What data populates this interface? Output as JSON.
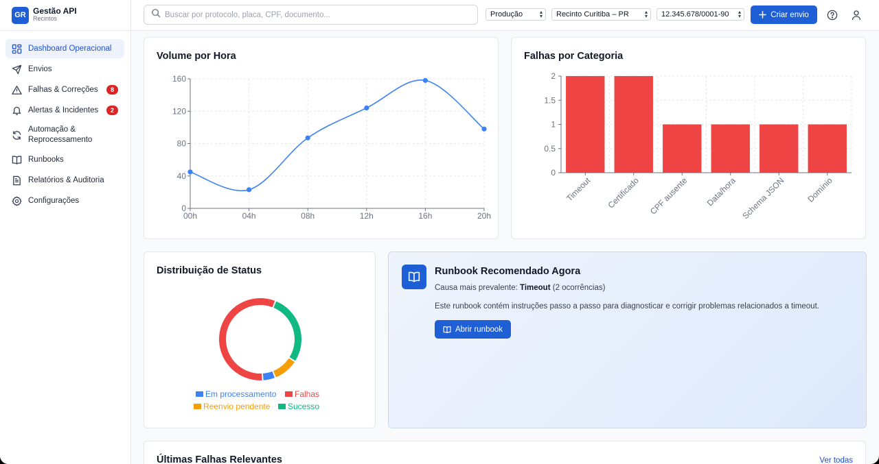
{
  "brand": {
    "logo": "GR",
    "title": "Gestão API",
    "subtitle": "Recintos"
  },
  "sidebar": {
    "items": [
      {
        "label": "Dashboard Operacional",
        "icon": "dashboard-grid-icon",
        "active": true
      },
      {
        "label": "Envios",
        "icon": "send-icon"
      },
      {
        "label": "Falhas & Correções",
        "icon": "warning-triangle-icon",
        "badge": "8"
      },
      {
        "label": "Alertas & Incidentes",
        "icon": "bell-icon",
        "badge": "2"
      },
      {
        "label": "Automação & Reprocessamento",
        "icon": "refresh-icon"
      },
      {
        "label": "Runbooks",
        "icon": "book-icon"
      },
      {
        "label": "Relatórios & Auditoria",
        "icon": "report-icon"
      },
      {
        "label": "Configurações",
        "icon": "gear-icon"
      }
    ]
  },
  "topbar": {
    "search_placeholder": "Buscar por protocolo, placa, CPF, documento...",
    "env_select": "Produção",
    "recinto_select": "Recinto Curitiba – PR",
    "cnpj_select": "12.345.678/0001-90",
    "create_button": "Criar envio"
  },
  "volume_card": {
    "title": "Volume por Hora",
    "chart_data": {
      "type": "line",
      "x": [
        "00h",
        "04h",
        "08h",
        "12h",
        "16h",
        "20h"
      ],
      "values": [
        45,
        23,
        87,
        124,
        158,
        98
      ],
      "ylim": [
        0,
        160
      ],
      "yticks": [
        0,
        40,
        80,
        120,
        160
      ],
      "grid": true,
      "color": "#3b82f6"
    }
  },
  "falhas_card": {
    "title": "Falhas por Categoria",
    "chart_data": {
      "type": "bar",
      "categories": [
        "Timeout",
        "Certificado",
        "CPF ausente",
        "Data/hora",
        "Schema JSON",
        "Domínio"
      ],
      "values": [
        2,
        2,
        1,
        1,
        1,
        1
      ],
      "ylim": [
        0,
        2
      ],
      "yticks": [
        "0",
        "0.5",
        "1",
        "1.5",
        "2"
      ],
      "grid": true,
      "color": "#ef4444"
    }
  },
  "status_card": {
    "title": "Distribuição de Status",
    "chart_data": {
      "type": "pie",
      "variant": "donut",
      "slices": [
        {
          "name": "Sucesso",
          "value": 28,
          "color": "#10b981"
        },
        {
          "name": "Reenvio pendente",
          "value": 10,
          "color": "#f59e0b"
        },
        {
          "name": "Em processamento",
          "value": 5,
          "color": "#3b82f6"
        },
        {
          "name": "Falhas",
          "value": 57,
          "color": "#ef4444"
        }
      ]
    },
    "legend": {
      "processing": "Em processamento",
      "failures": "Falhas",
      "pending": "Reenvio pendente",
      "success": "Sucesso"
    }
  },
  "runbook_card": {
    "title": "Runbook Recomendado Agora",
    "cause_prefix": "Causa mais prevalente:",
    "cause_value": "Timeout",
    "cause_suffix": "(2 ocorrências)",
    "description": "Este runbook contém instruções passo a passo para diagnosticar e corrigir problemas relacionados a timeout.",
    "button": "Abrir runbook"
  },
  "recent_card": {
    "title": "Últimas Falhas Relevantes",
    "link": "Ver todas"
  },
  "colors": {
    "accent": "#1f5fd6",
    "danger": "#dc2626"
  }
}
